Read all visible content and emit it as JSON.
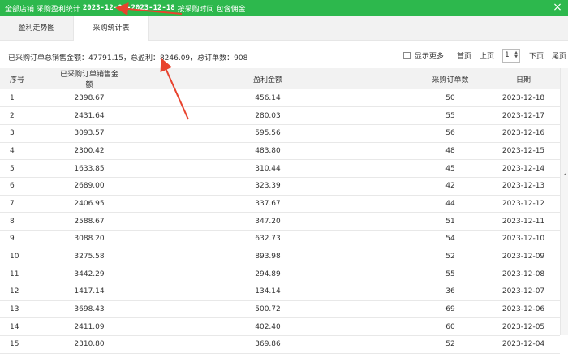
{
  "window": {
    "title_prefix": "全部店铺 采购盈利统计",
    "date_range": "2023-12-01-2023-12-18",
    "title_suffix": "按采购时间 包含佣金",
    "close_label": "×"
  },
  "tabs": [
    {
      "label": "盈利走势图",
      "active": false
    },
    {
      "label": "采购统计表",
      "active": true
    }
  ],
  "summary": "已采购订单总销售金额：47791.15，总盈利：8246.09，总订单数：908",
  "pager": {
    "show_more_label": "显示更多",
    "first_label": "首页",
    "prev_label": "上页",
    "page_value": "1",
    "next_label": "下页",
    "last_label": "尾页"
  },
  "table": {
    "headers": [
      "序号",
      "已采购订单销售金额",
      "盈利金额",
      "采购订单数",
      "日期"
    ],
    "rows": [
      [
        "1",
        "2398.67",
        "456.14",
        "50",
        "2023-12-18"
      ],
      [
        "2",
        "2431.64",
        "280.03",
        "55",
        "2023-12-17"
      ],
      [
        "3",
        "3093.57",
        "595.56",
        "56",
        "2023-12-16"
      ],
      [
        "4",
        "2300.42",
        "483.80",
        "48",
        "2023-12-15"
      ],
      [
        "5",
        "1633.85",
        "310.44",
        "45",
        "2023-12-14"
      ],
      [
        "6",
        "2689.00",
        "323.39",
        "42",
        "2023-12-13"
      ],
      [
        "7",
        "2406.95",
        "337.67",
        "44",
        "2023-12-12"
      ],
      [
        "8",
        "2588.67",
        "347.20",
        "51",
        "2023-12-11"
      ],
      [
        "9",
        "3088.20",
        "632.73",
        "54",
        "2023-12-10"
      ],
      [
        "10",
        "3275.58",
        "893.98",
        "52",
        "2023-12-09"
      ],
      [
        "11",
        "3442.29",
        "294.89",
        "55",
        "2023-12-08"
      ],
      [
        "12",
        "1417.14",
        "134.14",
        "36",
        "2023-12-07"
      ],
      [
        "13",
        "3698.43",
        "500.72",
        "69",
        "2023-12-06"
      ],
      [
        "14",
        "2411.09",
        "402.40",
        "60",
        "2023-12-05"
      ],
      [
        "15",
        "2310.80",
        "369.86",
        "52",
        "2023-12-04"
      ]
    ]
  },
  "colors": {
    "titlebar": "#2db84d",
    "annotation_arrow": "#e8432e"
  }
}
